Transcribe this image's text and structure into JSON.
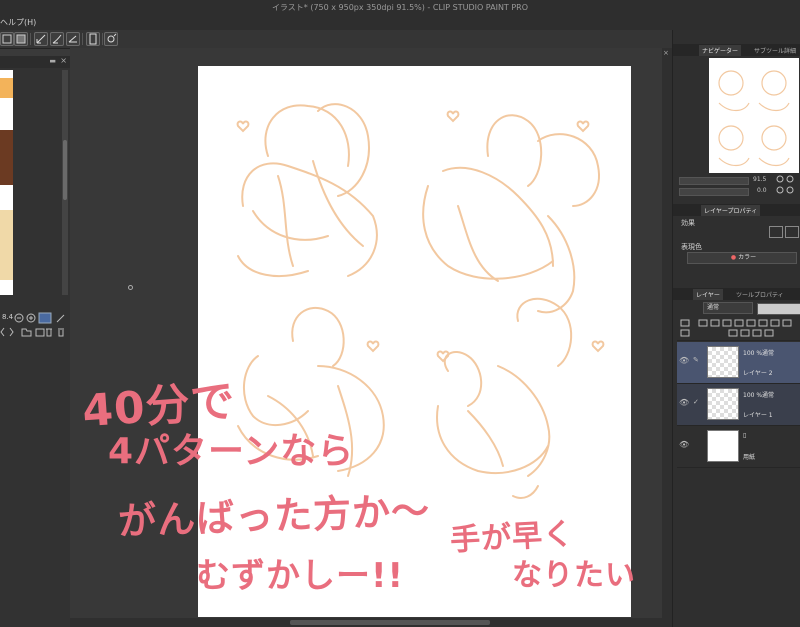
{
  "app": {
    "title": "イラスト* (750 x 950px 350dpi 91.5%) - CLIP STUDIO PAINT PRO",
    "menu_help": "ヘルプ(H)"
  },
  "colors": {
    "accent_selected": "#4a5570",
    "caption": "#e96e7e",
    "sketch": "#f2c8a0"
  },
  "toolbar": {
    "icons": [
      "square-icon",
      "pen-stroke-icon",
      "brush-stroke-icon",
      "ruler-icon",
      "device-icon",
      "settings-icon"
    ]
  },
  "left_panel": {
    "zoom_value": "8.4"
  },
  "navigator": {
    "tab_label": "ナビゲーター",
    "tab_other": "サブツール詳細",
    "zoom_value": "91.5",
    "rotate_value": "0.0"
  },
  "layer_property": {
    "tab_label": "レイヤープロパティ",
    "effect_label": "効果",
    "color_label": "表現色",
    "color_value": "カラー"
  },
  "layers_panel": {
    "tab_label": "レイヤー",
    "tab_other": "ツールプロパティ",
    "blend_mode": "通常",
    "layers": [
      {
        "mode": "100 %通常",
        "name": "レイヤー 2",
        "selected": true
      },
      {
        "mode": "100 %通常",
        "name": "レイヤー 1",
        "selected": false
      },
      {
        "mode": "",
        "name": "用紙",
        "selected": false
      }
    ]
  },
  "captions": {
    "line1": "40分で",
    "line2": "4パターンなら",
    "line3": "がんばった方か～",
    "line4": "むずかしー!!",
    "right1": "手が早く",
    "right2": "なりたい"
  }
}
